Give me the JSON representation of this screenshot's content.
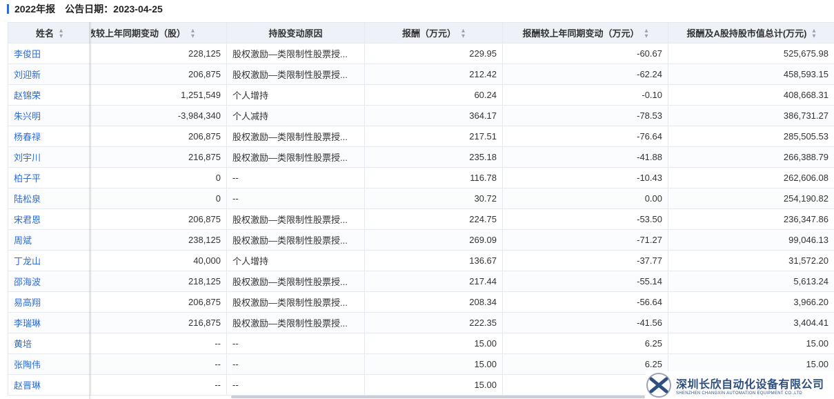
{
  "header": {
    "title": "2022年报",
    "date_label": "公告日期：",
    "date_value": "2023-04-25"
  },
  "columns": [
    "姓名",
    "持股数较上年同期变动（股）",
    "持股变动原因",
    "报酬（万元）",
    "报酬较上年同期变动（万元）",
    "报酬及A股持股市值总计(万元)"
  ],
  "rows": [
    {
      "name": "李俊田",
      "share_change": "228,125",
      "reason": "股权激励—类限制性股票授...",
      "pay": "229.95",
      "pay_change": "-60.67",
      "total": "525,675.98"
    },
    {
      "name": "刘迎新",
      "share_change": "206,875",
      "reason": "股权激励—类限制性股票授...",
      "pay": "212.42",
      "pay_change": "-62.24",
      "total": "458,593.15"
    },
    {
      "name": "赵锦荣",
      "share_change": "1,251,549",
      "reason": "个人增持",
      "pay": "60.24",
      "pay_change": "-0.10",
      "total": "408,668.31"
    },
    {
      "name": "朱兴明",
      "share_change": "-3,984,340",
      "reason": "个人减持",
      "pay": "364.17",
      "pay_change": "-78.53",
      "total": "386,731.27"
    },
    {
      "name": "杨春禄",
      "share_change": "206,875",
      "reason": "股权激励—类限制性股票授...",
      "pay": "217.51",
      "pay_change": "-76.64",
      "total": "285,505.53"
    },
    {
      "name": "刘宇川",
      "share_change": "216,875",
      "reason": "股权激励—类限制性股票授...",
      "pay": "235.18",
      "pay_change": "-41.88",
      "total": "266,388.79"
    },
    {
      "name": "柏子平",
      "share_change": "0",
      "reason": "--",
      "pay": "116.78",
      "pay_change": "-10.43",
      "total": "262,606.08"
    },
    {
      "name": "陆松泉",
      "share_change": "0",
      "reason": "--",
      "pay": "30.72",
      "pay_change": "0.00",
      "total": "254,190.82"
    },
    {
      "name": "宋君恩",
      "share_change": "206,875",
      "reason": "股权激励—类限制性股票授...",
      "pay": "224.75",
      "pay_change": "-53.50",
      "total": "236,347.86"
    },
    {
      "name": "周斌",
      "share_change": "238,125",
      "reason": "股权激励—类限制性股票授...",
      "pay": "269.09",
      "pay_change": "-71.27",
      "total": "99,046.13"
    },
    {
      "name": "丁龙山",
      "share_change": "40,000",
      "reason": "个人增持",
      "pay": "136.67",
      "pay_change": "-37.77",
      "total": "31,572.20"
    },
    {
      "name": "邵海波",
      "share_change": "218,125",
      "reason": "股权激励—类限制性股票授...",
      "pay": "217.44",
      "pay_change": "-55.14",
      "total": "5,613.24"
    },
    {
      "name": "易高翔",
      "share_change": "206,875",
      "reason": "股权激励—类限制性股票授...",
      "pay": "208.34",
      "pay_change": "-56.64",
      "total": "3,966.20"
    },
    {
      "name": "李瑞琳",
      "share_change": "216,875",
      "reason": "股权激励—类限制性股票授...",
      "pay": "222.35",
      "pay_change": "-41.56",
      "total": "3,404.41"
    },
    {
      "name": "黄培",
      "share_change": "--",
      "reason": "--",
      "pay": "15.00",
      "pay_change": "6.25",
      "total": "15.00"
    },
    {
      "name": "张陶伟",
      "share_change": "--",
      "reason": "--",
      "pay": "15.00",
      "pay_change": "6.25",
      "total": "15.00"
    },
    {
      "name": "赵晋琳",
      "share_change": "--",
      "reason": "--",
      "pay": "15.00",
      "pay_change": "",
      "total": ""
    }
  ],
  "watermark": {
    "cn": "深圳长欣自动化设备有限公司",
    "en": "SHENZHEN CHANGXIN AUTOMATION EQUIPMENT CO.,LTD"
  },
  "colors": {
    "accent": "#2c6bd7",
    "header_bg": "#eef1f7",
    "watermark": "#2f4f7f"
  },
  "icons": {
    "sort": "sort-icon"
  }
}
